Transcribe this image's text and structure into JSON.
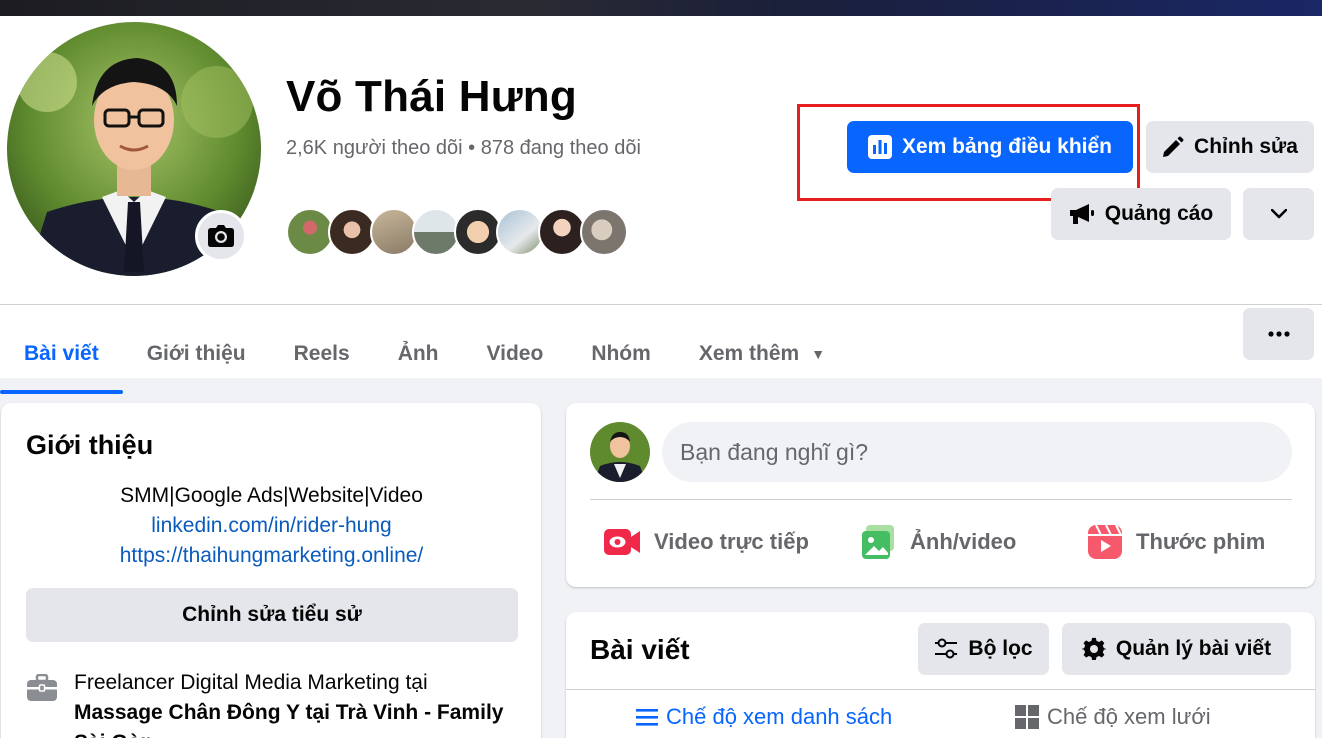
{
  "profile": {
    "name": "Võ Thái Hưng",
    "followers": "2,6K người theo dõi • 878 đang theo dõi"
  },
  "actions": {
    "dashboard": "Xem bảng điều khiển",
    "edit": "Chỉnh sửa",
    "ads": "Quảng cáo"
  },
  "tabs": [
    {
      "label": "Bài viết"
    },
    {
      "label": "Giới thiệu"
    },
    {
      "label": "Reels"
    },
    {
      "label": "Ảnh"
    },
    {
      "label": "Video"
    },
    {
      "label": "Nhóm"
    },
    {
      "label": "Xem thêm"
    }
  ],
  "intro": {
    "title": "Giới thiệu",
    "bio": "SMM|Google Ads|Website|Video",
    "link1": "linkedin.com/in/rider-hung",
    "link2": "https://thaihungmarketing.online/",
    "edit_bio": "Chỉnh sửa tiểu sử",
    "work_prefix": "Freelancer Digital Media Marketing tại",
    "work_place": "Massage Chân Đông Y tại Trà Vinh - Family Sài Gòn"
  },
  "composer": {
    "placeholder": "Bạn đang nghĩ gì?",
    "live": "Video trực tiếp",
    "photo": "Ảnh/video",
    "reel": "Thước phim"
  },
  "posts": {
    "title": "Bài viết",
    "filter": "Bộ lọc",
    "manage": "Quản lý bài viết",
    "list_view": "Chế độ xem danh sách",
    "grid_view": "Chế độ xem lưới"
  },
  "colors": {
    "accent": "#0866ff",
    "highlight": "#e61e1e",
    "link": "#0a5bbd"
  }
}
